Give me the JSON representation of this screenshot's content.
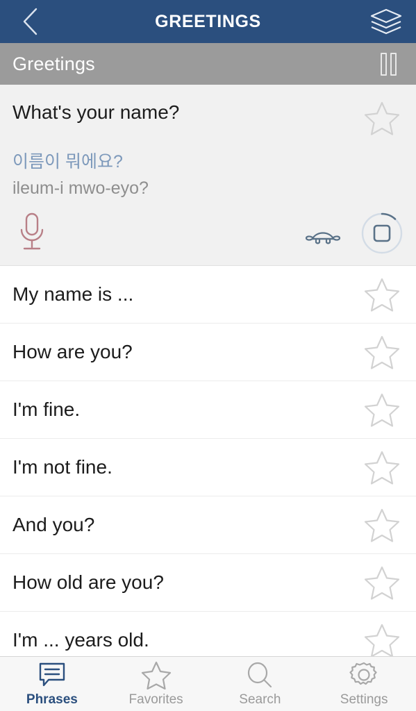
{
  "navbar": {
    "title": "GREETINGS",
    "back_icon": "chevron-left-icon",
    "layers_icon": "layers-icon"
  },
  "section": {
    "title": "Greetings",
    "pause_icon": "pause-icon"
  },
  "expanded_card": {
    "phrase": "What's your name?",
    "korean": "이름이 뭐에요?",
    "transliteration": "ileum-i mwo-eyo?",
    "star_icon": "star-outline-icon",
    "mic_icon": "microphone-icon",
    "slow_icon": "turtle-icon",
    "stop_icon": "stop-icon",
    "favorited": false
  },
  "phrases": [
    {
      "label": "My name is ...",
      "favorited": false
    },
    {
      "label": "How are you?",
      "favorited": false
    },
    {
      "label": "I'm fine.",
      "favorited": false
    },
    {
      "label": "I'm not fine.",
      "favorited": false
    },
    {
      "label": "And you?",
      "favorited": false
    },
    {
      "label": "How old are you?",
      "favorited": false
    },
    {
      "label": "I'm ... years old.",
      "favorited": false
    }
  ],
  "tabbar": {
    "tabs": [
      {
        "label": "Phrases",
        "icon": "speech-bubble-icon",
        "active": true
      },
      {
        "label": "Favorites",
        "icon": "star-outline-icon",
        "active": false
      },
      {
        "label": "Search",
        "icon": "magnifier-icon",
        "active": false
      },
      {
        "label": "Settings",
        "icon": "gear-icon",
        "active": false
      }
    ]
  },
  "colors": {
    "navbar_blue": "#2b4f7e",
    "section_gray": "#9b9b9b",
    "card_bg": "#f1f1f1",
    "korean_blue": "#7d99bb",
    "translit_gray": "#8e8e8e",
    "mic_rose": "#b87f87",
    "audio_slate": "#5a7288",
    "star_outline": "#cfcfcf",
    "tab_inactive": "#9a9a9a"
  }
}
